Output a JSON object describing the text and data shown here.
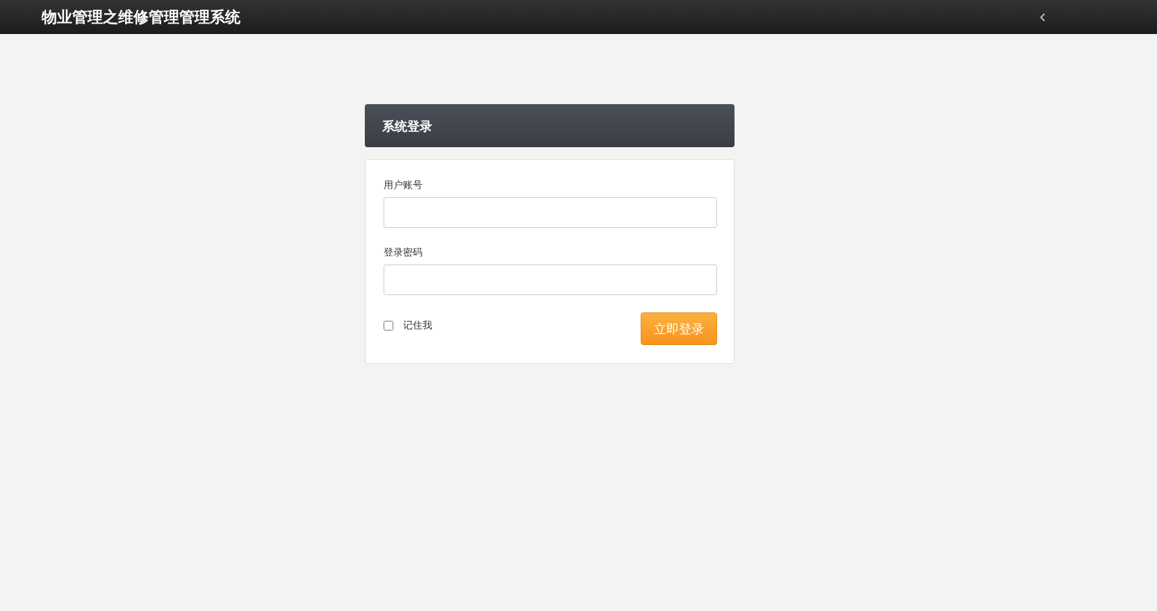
{
  "navbar": {
    "title": "物业管理之维修管理管理系统"
  },
  "login": {
    "title": "系统登录",
    "fields": [
      {
        "label": "用户账号"
      },
      {
        "label": "登录密码"
      }
    ],
    "remember": {
      "label": "记住我",
      "checked": false
    },
    "submit": "立即登录"
  }
}
